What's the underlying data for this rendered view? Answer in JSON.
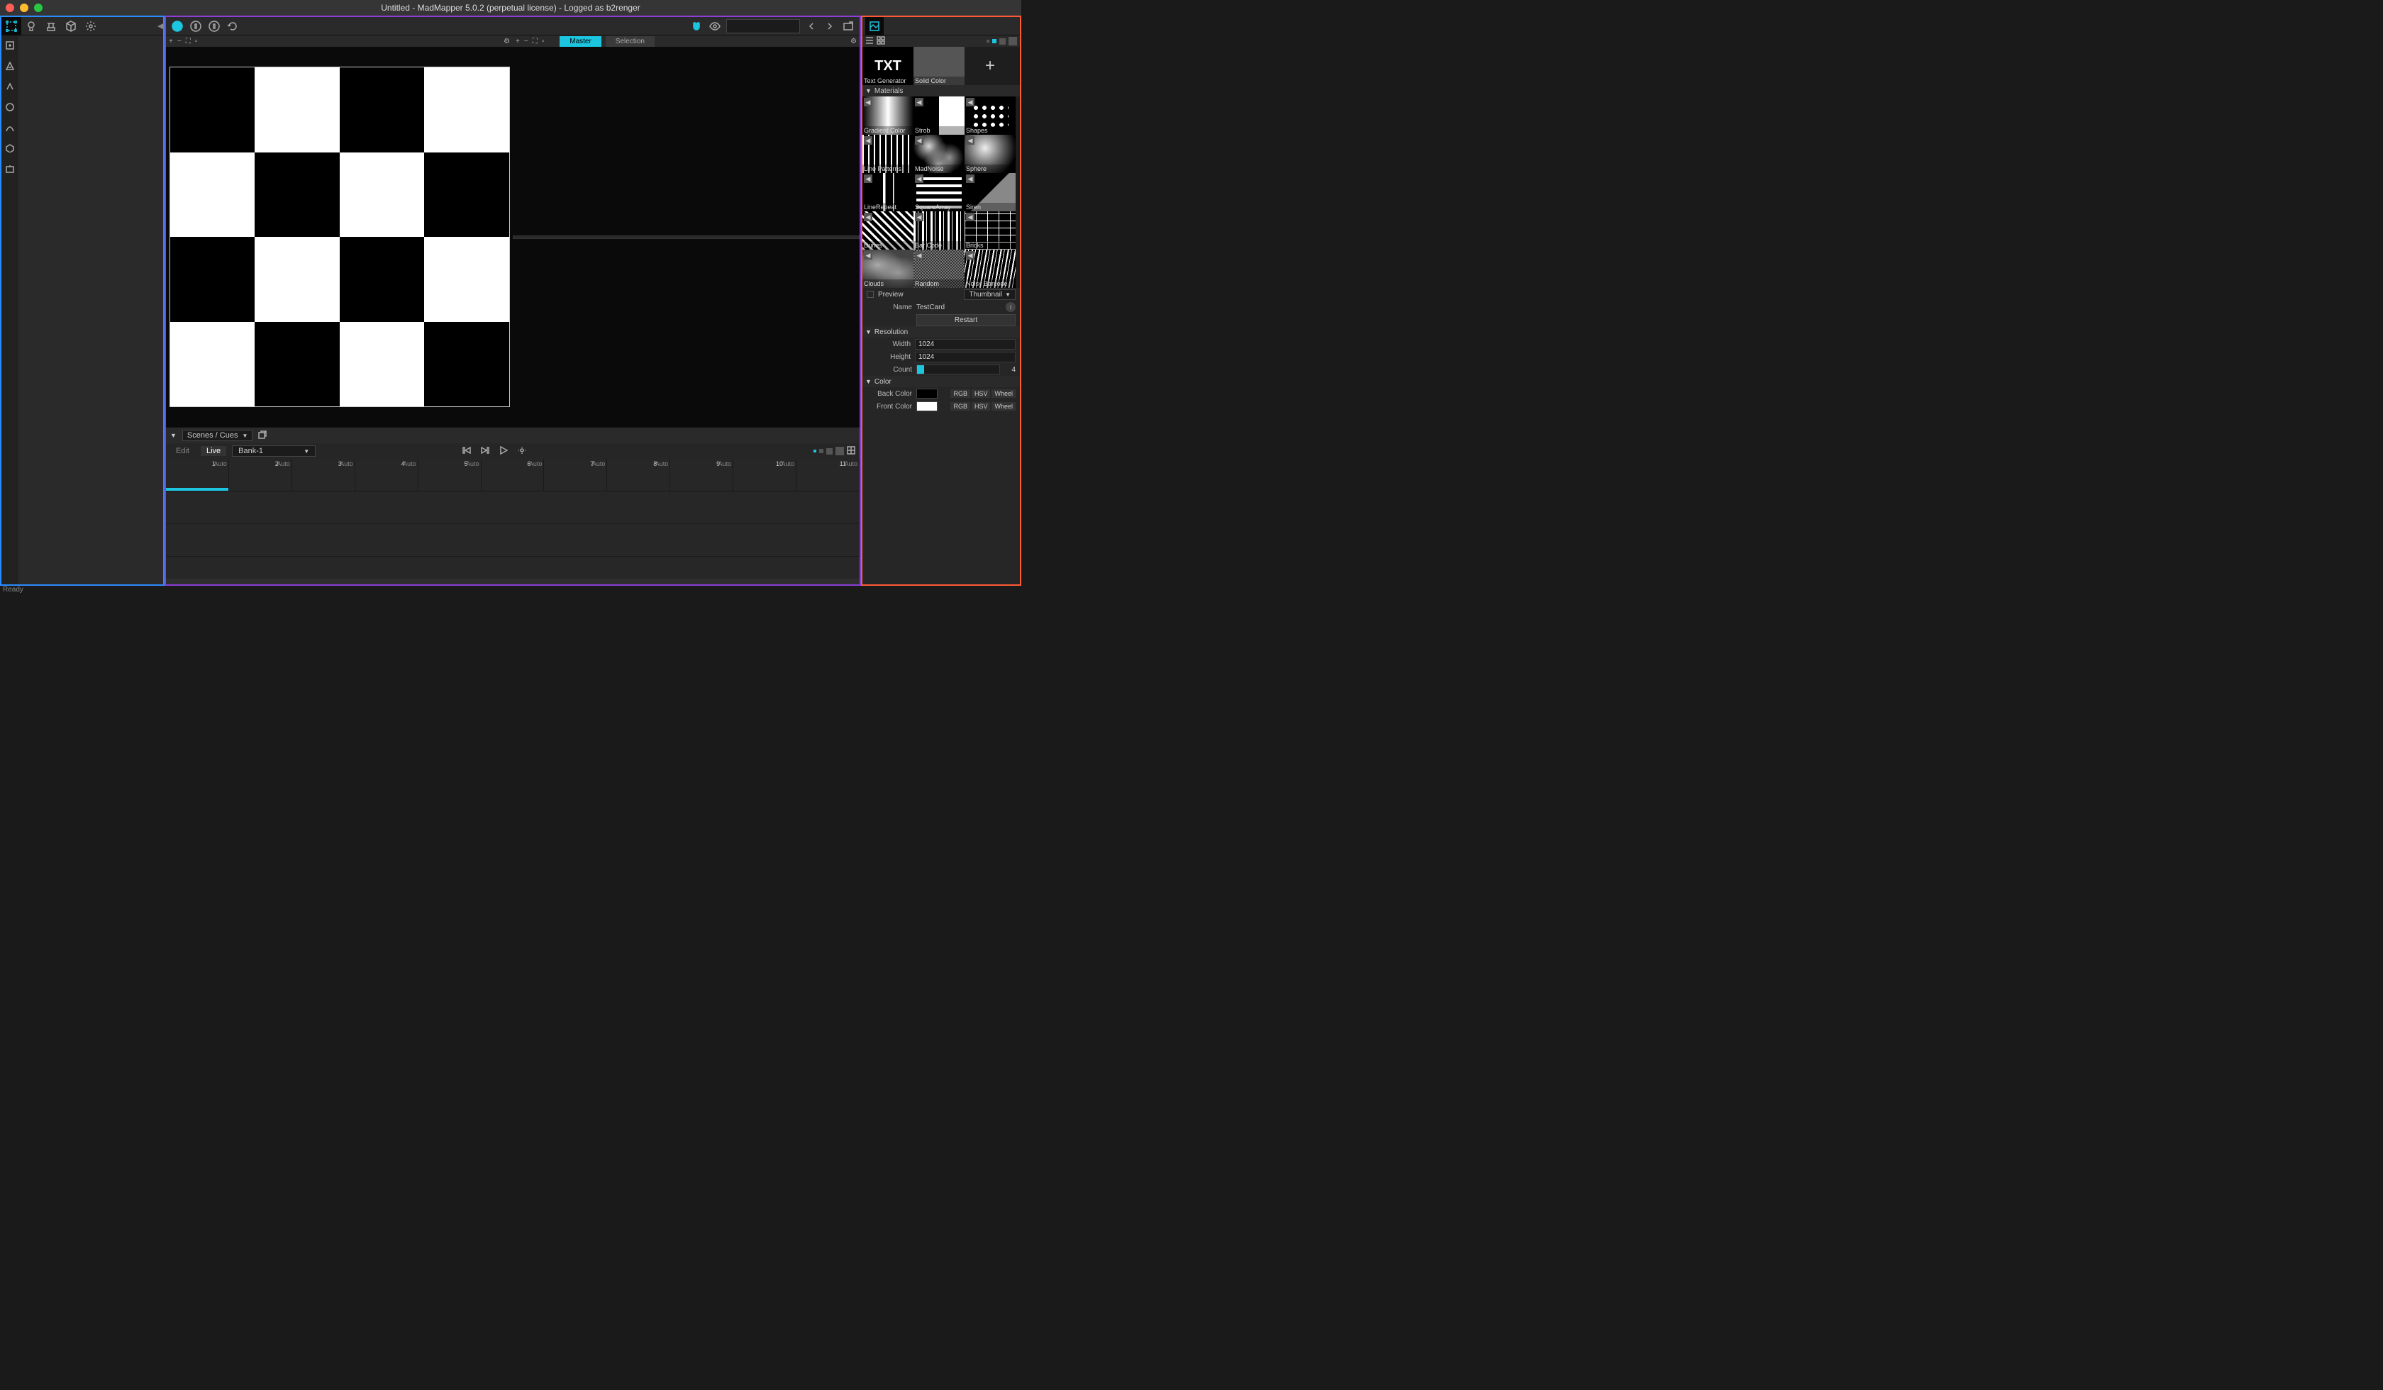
{
  "window": {
    "title": "Untitled - MadMapper 5.0.2 (perpetual license) - Logged as b2renger"
  },
  "statusbar": {
    "text": "Ready"
  },
  "left_toolbar": {
    "tabs": [
      "surfaces",
      "lights",
      "fixtures",
      "modules",
      "settings"
    ]
  },
  "viewport": {
    "tabs": {
      "master": "Master",
      "selection": "Selection"
    }
  },
  "scenes": {
    "header_label": "Scenes / Cues",
    "edit_label": "Edit",
    "live_label": "Live",
    "bank": "Bank-1",
    "auto_label": "Auto",
    "cells": [
      "1",
      "2",
      "3",
      "4",
      "5",
      "6",
      "7",
      "8",
      "9",
      "10",
      "11"
    ]
  },
  "library": {
    "top_row": [
      {
        "label": "Text Generator",
        "thumb": "th-txt",
        "text": "TXT"
      },
      {
        "label": "Solid Color",
        "thumb": "th-solid"
      }
    ],
    "materials_label": "Materials",
    "materials": [
      {
        "label": "Gradient Color",
        "thumb": "th-gradient"
      },
      {
        "label": "Strob",
        "thumb": "th-strob"
      },
      {
        "label": "Shapes",
        "thumb": "th-shapes"
      },
      {
        "label": "Line Patterns",
        "thumb": "th-lines"
      },
      {
        "label": "MadNoise",
        "thumb": "th-noise"
      },
      {
        "label": "Sphere",
        "thumb": "th-sphere"
      },
      {
        "label": "LineRepeat",
        "thumb": "th-linerepeat"
      },
      {
        "label": "SquareArray",
        "thumb": "th-squarearray"
      },
      {
        "label": "Siren",
        "thumb": "th-siren"
      },
      {
        "label": "Dunes",
        "thumb": "th-dunes"
      },
      {
        "label": "Bar Code",
        "thumb": "th-barcode"
      },
      {
        "label": "Bricks",
        "thumb": "th-bricks"
      },
      {
        "label": "Clouds",
        "thumb": "th-clouds"
      },
      {
        "label": "Random",
        "thumb": "th-random"
      },
      {
        "label": "Noisy Barcode",
        "thumb": "th-noisybarcode"
      }
    ]
  },
  "props": {
    "preview_label": "Preview",
    "preview_mode": "Thumbnail",
    "name_label": "Name",
    "name_value": "TestCard",
    "restart_label": "Restart",
    "resolution_label": "Resolution",
    "width_label": "Width",
    "width_value": "1024",
    "height_label": "Height",
    "height_value": "1024",
    "count_label": "Count",
    "count_value": "4",
    "color_label": "Color",
    "back_color_label": "Back Color",
    "front_color_label": "Front Color",
    "rgb": "RGB",
    "hsv": "HSV",
    "wheel": "Wheel",
    "back_color": "#000000",
    "front_color": "#ffffff"
  }
}
